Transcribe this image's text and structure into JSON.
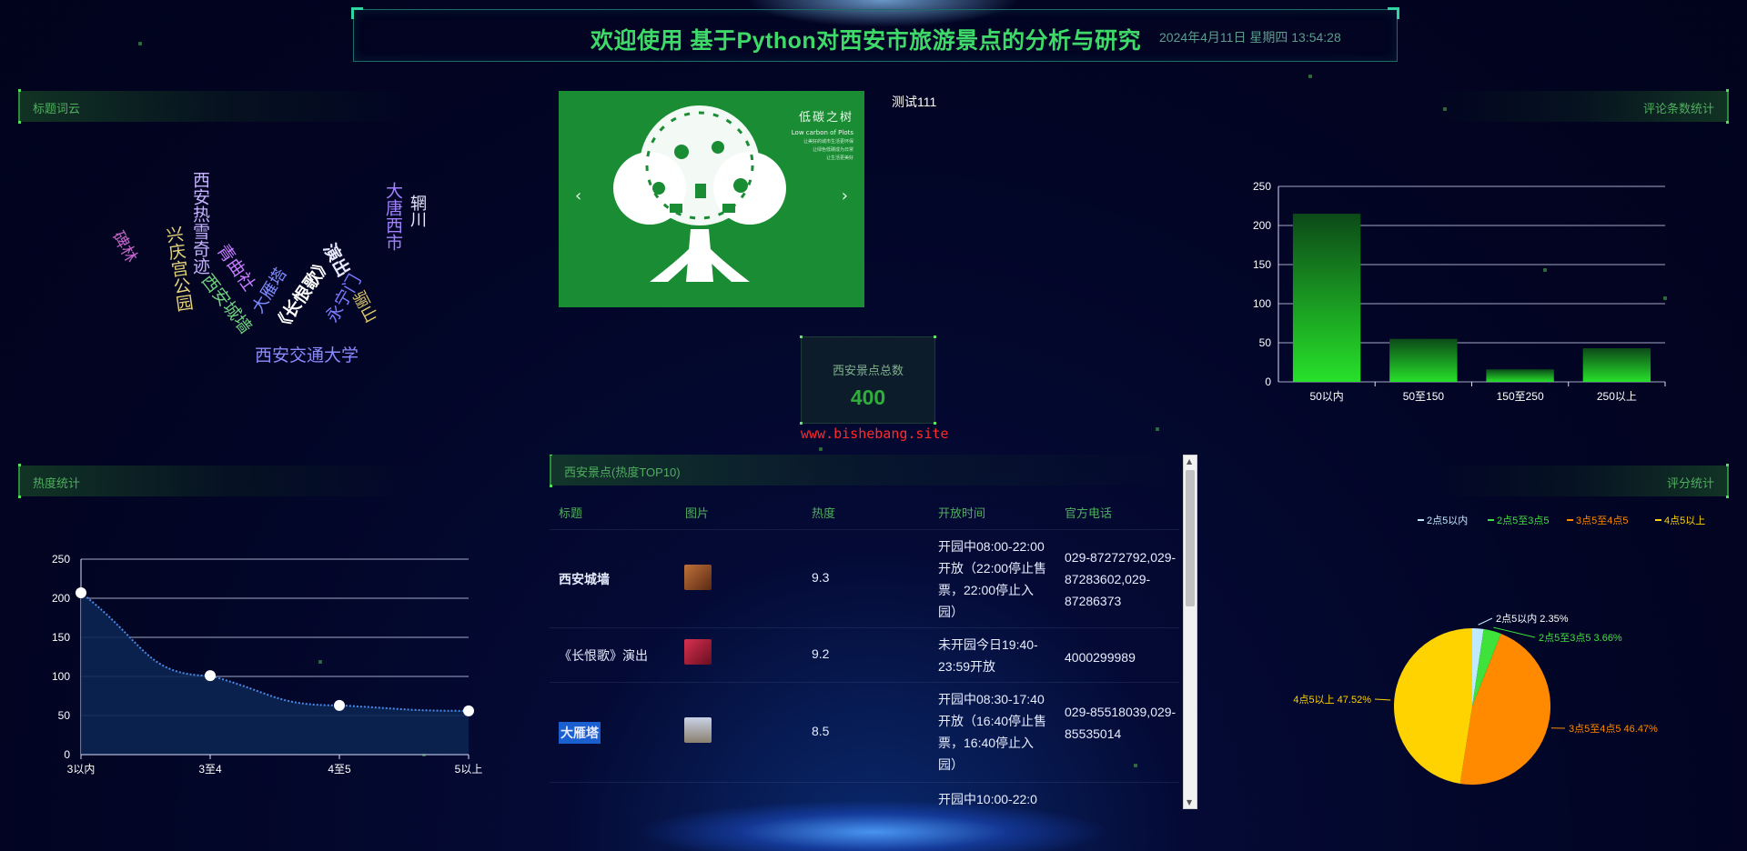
{
  "header": {
    "title": "欢迎使用 基于Python对西安市旅游景点的分析与研究",
    "datetime": "2024年4月11日 星期四 13:54:28"
  },
  "panels": {
    "wordcloud": "标题词云",
    "comments": "评论条数统计",
    "heat": "热度统计",
    "rating": "评分统计",
    "top10": "西安景点(热度TOP10)"
  },
  "wordcloud_words": [
    {
      "text": "碑林",
      "color": "#c264c8"
    },
    {
      "text": "西安热雪奇迹",
      "color": "#c7b3ff"
    },
    {
      "text": "兴庆宫公园",
      "color": "#e4d27a"
    },
    {
      "text": "青曲社",
      "color": "#c77dff"
    },
    {
      "text": "西安城墙",
      "color": "#6fd17e"
    },
    {
      "text": "大雁塔",
      "color": "#7f8cff"
    },
    {
      "text": "《长恨歌》",
      "color": "#ffffff"
    },
    {
      "text": "演出",
      "color": "#e8e8ff"
    },
    {
      "text": "永宁门",
      "color": "#7b7bff"
    },
    {
      "text": "骊山",
      "color": "#e0c86a"
    },
    {
      "text": "大唐西市",
      "color": "#a080ff"
    },
    {
      "text": "辋川",
      "color": "#e8e8ff"
    },
    {
      "text": "西安交通大学",
      "color": "#8b8bff"
    }
  ],
  "carousel": {
    "prev_arrow": "‹",
    "next_arrow": "›",
    "heading": "低碳之树",
    "subheading": "Low carbon of Plots",
    "caption_lines": [
      "让美好的城市生活更环保",
      "让绿色低碳成为日常",
      "让生活更美好"
    ],
    "label": "测试111"
  },
  "total": {
    "label": "西安景点总数",
    "value": "400"
  },
  "watermark": "www.bishebang.site",
  "table": {
    "headers": [
      "标题",
      "图片",
      "热度",
      "开放时间",
      "官方电话"
    ],
    "rows": [
      {
        "title": "西安城墙",
        "hot": "9.3",
        "time": "开园中08:00-22:00开放（22:00停止售票，22:00停止入园）",
        "phone": "029-87272792,029-87283602,029-87286373",
        "thumb_color": "#c0703a"
      },
      {
        "title": "《长恨歌》演出",
        "hot": "9.2",
        "time": "未开园今日19:40-23:59开放",
        "phone": "4000299989",
        "thumb_color": "#b2203a"
      },
      {
        "title": "大雁塔",
        "hot": "8.5",
        "time": "开园中08:30-17:40开放（16:40停止售票，16:40停止入园）",
        "phone": "029-85518039,029-85535014",
        "thumb_color": "#a0a7b8"
      },
      {
        "title": "",
        "hot": "",
        "time": "开园中10:00-22:0",
        "phone": "",
        "thumb_color": "#000000"
      }
    ]
  },
  "comments_chart": {
    "type": "bar",
    "categories": [
      "50以内",
      "50至150",
      "150至250",
      "250以上"
    ],
    "values": [
      215,
      55,
      16,
      43
    ],
    "yticks": [
      "0",
      "50",
      "100",
      "150",
      "200",
      "250"
    ],
    "ylim": [
      0,
      250
    ],
    "color": "#27e12a"
  },
  "heat_chart": {
    "type": "line",
    "categories": [
      "3以内",
      "3至4",
      "4至5",
      "5以上"
    ],
    "values": [
      207,
      101,
      63,
      56
    ],
    "yticks": [
      "0",
      "50",
      "100",
      "150",
      "200",
      "250"
    ],
    "ylim": [
      0,
      250
    ],
    "color": "#4a8ae6"
  },
  "rating_chart": {
    "type": "pie",
    "legend": [
      "2点5以内",
      "2点5至3点5",
      "3点5至4点5",
      "4点5以上"
    ],
    "slices": [
      {
        "name": "2点5以内",
        "value": 2.35,
        "label": "2点5以内 2.35%",
        "color": "#bfe9ff"
      },
      {
        "name": "2点5至3点5",
        "value": 3.66,
        "label": "2点5至3点5 3.66%",
        "color": "#3ee23a"
      },
      {
        "name": "3点5至4点5",
        "value": 46.47,
        "label": "3点5至4点5 46.47%",
        "color": "#ff8a00"
      },
      {
        "name": "4点5以上",
        "value": 47.52,
        "label": "4点5以上 47.52%",
        "color": "#ffd300"
      }
    ]
  },
  "chart_data": [
    {
      "type": "bar",
      "title": "评论条数统计",
      "categories": [
        "50以内",
        "50至150",
        "150至250",
        "250以上"
      ],
      "values": [
        215,
        55,
        16,
        43
      ],
      "ylim": [
        0,
        250
      ]
    },
    {
      "type": "line",
      "title": "热度统计",
      "categories": [
        "3以内",
        "3至4",
        "4至5",
        "5以上"
      ],
      "values": [
        207,
        101,
        63,
        56
      ],
      "ylim": [
        0,
        250
      ]
    },
    {
      "type": "pie",
      "title": "评分统计",
      "categories": [
        "2点5以内",
        "2点5至3点5",
        "3点5至4点5",
        "4点5以上"
      ],
      "values": [
        2.35,
        3.66,
        46.47,
        47.52
      ]
    }
  ]
}
